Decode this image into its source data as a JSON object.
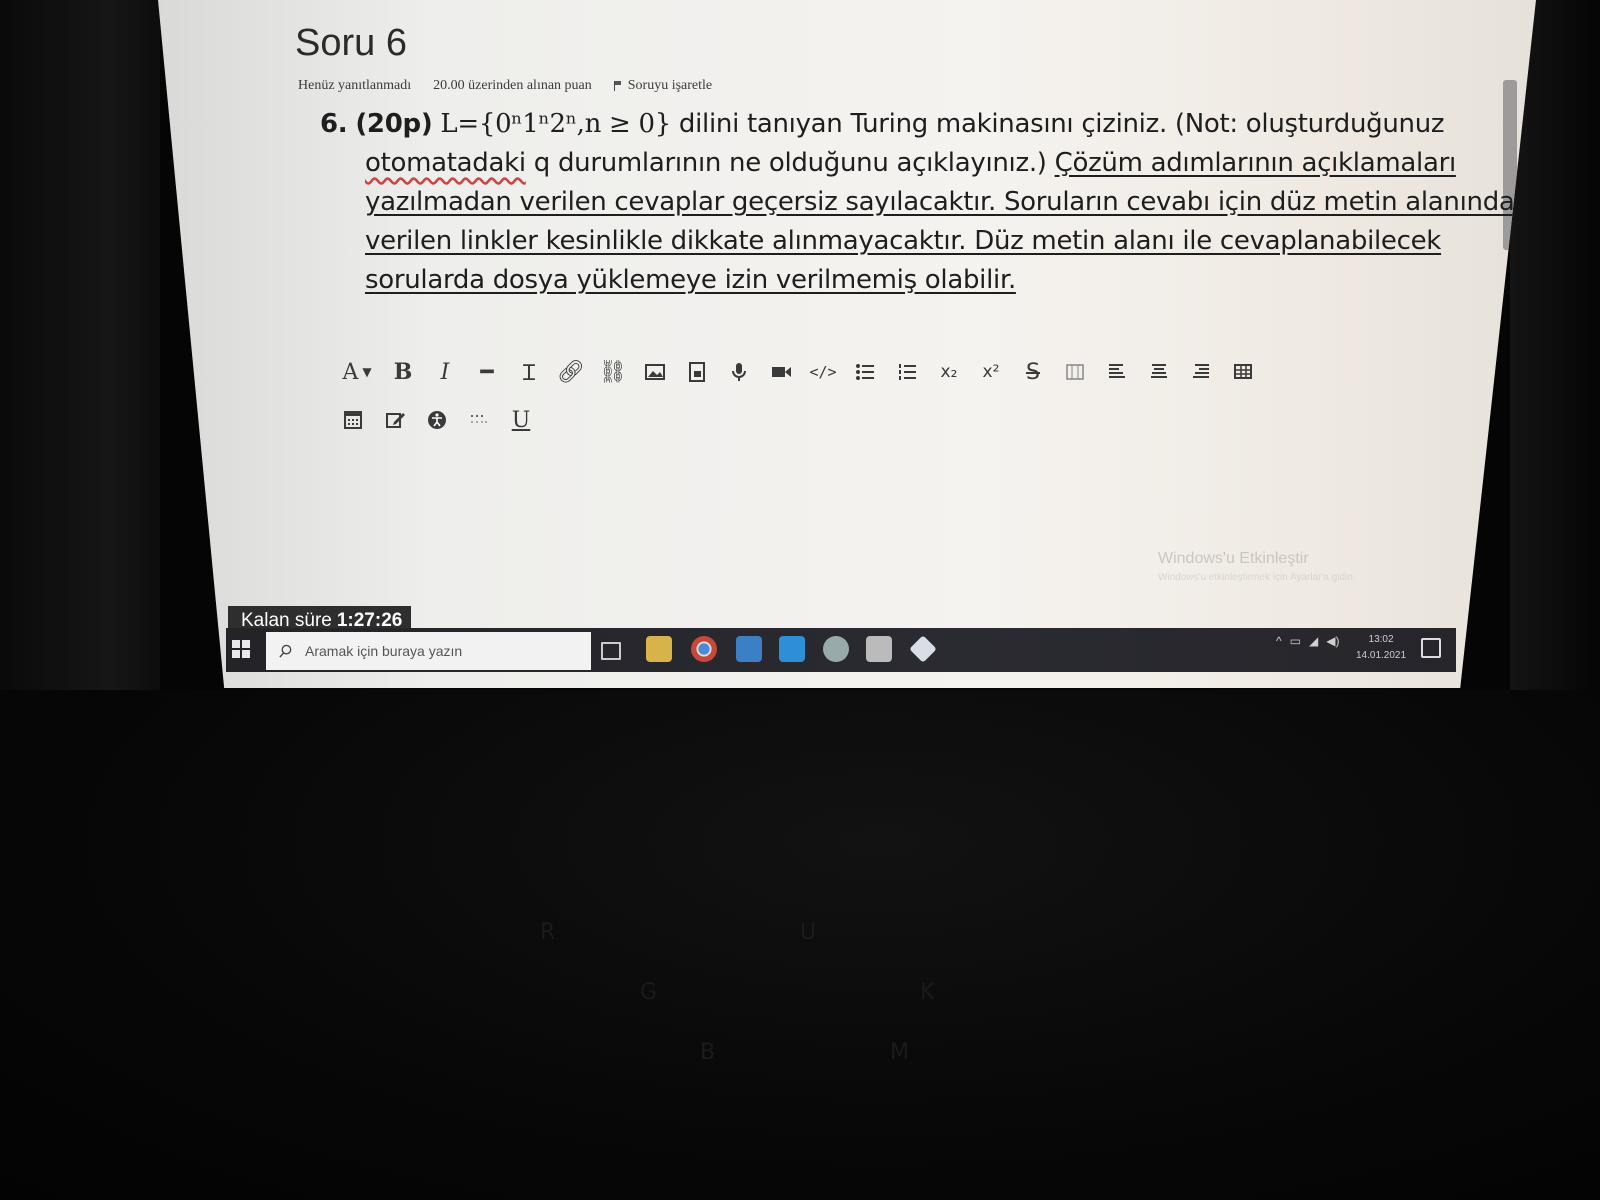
{
  "question": {
    "title": "Soru 6",
    "status": "Henüz yanıtlanmadı",
    "points": "20.00 üzerinden alınan puan",
    "flag_label": "Soruyu işaretle",
    "number": "6.",
    "points_tag": "(20p)",
    "language_expr": "L={0ⁿ1ⁿ2ⁿ,n ≥ 0}",
    "line1_rest": "dilini tanıyan Turing makinasını çiziniz. (Not: oluşturduğunuz",
    "line2_a": "otomatadaki",
    "line2_b": "q durumlarının ne olduğunu açıklayınız.)",
    "line2_c": "Çözüm adımlarının açıklamaları",
    "line3": "yazılmadan verilen cevaplar geçersiz sayılacaktır. Soruların cevabı için düz metin alanında",
    "line4": "verilen linkler kesinlikle dikkate alınmayacaktır. Düz metin alanı ile cevaplanabilecek",
    "line5": "sorularda dosya yüklemeye izin verilmemiş olabilir."
  },
  "toolbar": {
    "font_label": "A",
    "bold": "B",
    "italic": "I",
    "underline": "U",
    "row1_icons": [
      "font-icon",
      "bold-icon",
      "italic-icon",
      "horizontal-rule-icon",
      "clear-format-icon",
      "link-icon",
      "unlink-icon",
      "image-icon",
      "media-icon",
      "microphone-icon",
      "video-icon",
      "code-icon",
      "bullet-list-icon",
      "numbered-list-icon",
      "subscript-icon",
      "superscript-icon",
      "strikethrough-icon",
      "columns-icon",
      "align-left-icon",
      "align-center-icon",
      "align-right-icon",
      "table-icon"
    ],
    "row2_icons": [
      "calculator-icon",
      "edit-icon",
      "accessibility-icon",
      "special-chars-icon",
      "underline-icon"
    ]
  },
  "watermark": {
    "title": "Windows'u Etkinleştir",
    "subtitle": "Windows'u etkinleştirmek için Ayarlar'a gidin."
  },
  "timer": {
    "label": "Kalan süre",
    "value": "1:27:26"
  },
  "taskbar": {
    "search_placeholder": "Aramak için buraya yazın",
    "time": "13:02",
    "date": "14.01.2021",
    "apps": [
      "task-view",
      "file-explorer",
      "chrome",
      "instagram",
      "twitter",
      "whatsapp",
      "app-chart",
      "app-cube"
    ],
    "colors": {
      "chrome": "#4b8bd6",
      "instagram": "#3b7fc4",
      "twitter": "#2e8fd6",
      "whatsapp": "#9aa",
      "explorer": "#d8b34a"
    }
  }
}
